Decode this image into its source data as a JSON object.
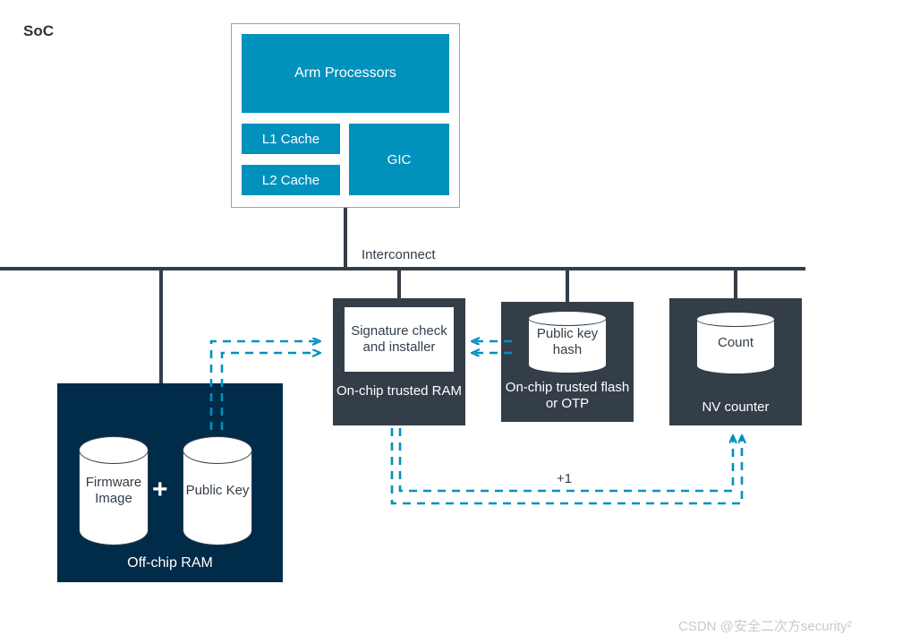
{
  "diagram": {
    "title": "SoC",
    "watermark": "CSDN @安全二次方security²",
    "colors": {
      "arm_blue": "#0091BD",
      "slate": "#333E48",
      "navy": "#002B49",
      "teal_arrow": "#0091BD",
      "white": "#ffffff",
      "outline_gray": "#9aa2a8"
    }
  },
  "processor_cluster": {
    "arm_processors": "Arm Processors",
    "l1_cache": "L1 Cache",
    "l2_cache": "L2 Cache",
    "gic": "GIC"
  },
  "bus": {
    "label": "Interconnect"
  },
  "blocks": {
    "trusted_ram": {
      "inner_label": "Signature\ncheck and\ninstaller",
      "caption": "On-chip trusted\nRAM"
    },
    "trusted_flash": {
      "cylinder_label": "Public key\nhash",
      "caption": "On-chip trusted\nflash or OTP"
    },
    "nv_counter": {
      "cylinder_label": "Count",
      "caption": "NV counter"
    },
    "off_chip_ram": {
      "firmware_cylinder": "Firmware\nImage",
      "public_key_cylinder": "Public\nKey",
      "plus": "+",
      "caption": "Off-chip RAM"
    }
  },
  "connections": {
    "increment_label": "+1"
  }
}
